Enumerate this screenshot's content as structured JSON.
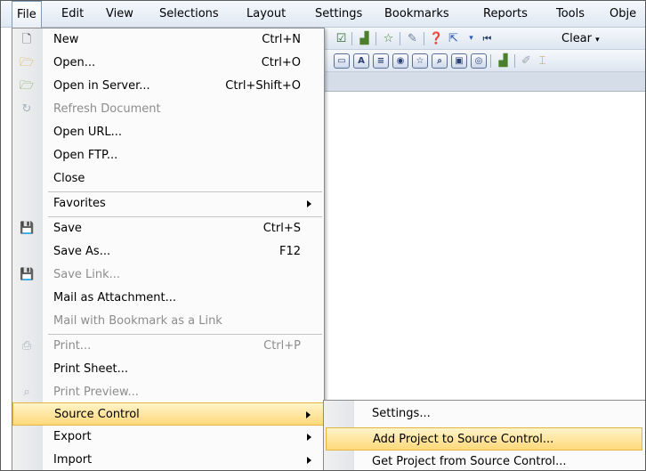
{
  "menubar": {
    "items": [
      "File",
      "Edit",
      "View",
      "Selections",
      "Layout",
      "Settings",
      "Bookmarks",
      "Reports",
      "Tools",
      "Obje"
    ],
    "active": "File"
  },
  "toolbar": {
    "clear_label": "Clear"
  },
  "file_menu": {
    "items": [
      {
        "label": "New",
        "shortcut": "Ctrl+N",
        "icon": "new-document-icon"
      },
      {
        "label": "Open...",
        "shortcut": "Ctrl+O",
        "icon": "open-folder-icon"
      },
      {
        "label": "Open in Server...",
        "shortcut": "Ctrl+Shift+O",
        "icon": "open-server-icon"
      },
      {
        "label": "Refresh Document",
        "shortcut": "",
        "icon": "refresh-icon",
        "disabled": true
      },
      {
        "label": "Open URL...",
        "shortcut": ""
      },
      {
        "label": "Open FTP...",
        "shortcut": ""
      },
      {
        "label": "Close",
        "shortcut": ""
      },
      {
        "label": "Favorites",
        "shortcut": "",
        "submenu": true
      },
      {
        "label": "Save",
        "shortcut": "Ctrl+S",
        "icon": "save-icon"
      },
      {
        "label": "Save As...",
        "shortcut": "F12"
      },
      {
        "label": "Save Link...",
        "shortcut": "",
        "icon": "save-link-icon",
        "disabled": true
      },
      {
        "label": "Mail as Attachment...",
        "shortcut": ""
      },
      {
        "label": "Mail with Bookmark as a Link",
        "shortcut": "",
        "disabled": true
      },
      {
        "label": "Print...",
        "shortcut": "Ctrl+P",
        "icon": "print-icon",
        "disabled": true
      },
      {
        "label": "Print Sheet...",
        "shortcut": ""
      },
      {
        "label": "Print Preview...",
        "shortcut": "",
        "icon": "print-preview-icon",
        "disabled": true
      },
      {
        "label": "Source Control",
        "shortcut": "",
        "submenu": true,
        "highlighted": true
      },
      {
        "label": "Export",
        "shortcut": "",
        "submenu": true
      },
      {
        "label": "Import",
        "shortcut": "",
        "submenu": true
      }
    ]
  },
  "source_control_menu": {
    "items": [
      {
        "label": "Settings..."
      },
      {
        "label": "Add Project to Source Control...",
        "highlighted": true
      },
      {
        "label": "Get Project from Source Control..."
      }
    ]
  },
  "colors": {
    "highlight": "#ffd97a",
    "highlight_border": "#e5b441",
    "disabled_text": "#8d8d8d"
  }
}
